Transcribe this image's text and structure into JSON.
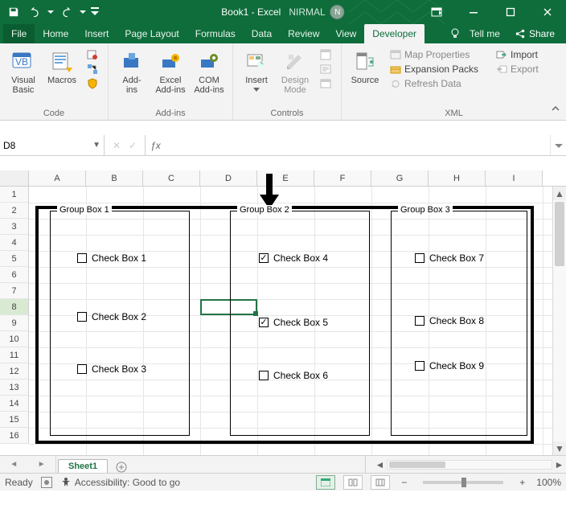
{
  "titlebar": {
    "app_title": "Book1  -  Excel",
    "username": "NIRMAL",
    "avatar_initial": "N"
  },
  "tabs": {
    "file": "File",
    "home": "Home",
    "insert": "Insert",
    "page_layout": "Page Layout",
    "formulas": "Formulas",
    "data": "Data",
    "review": "Review",
    "view": "View",
    "developer": "Developer",
    "tellme": "Tell me",
    "share": "Share"
  },
  "ribbon": {
    "code": {
      "label": "Code",
      "visual_basic": "Visual\nBasic",
      "macros": "Macros"
    },
    "addins": {
      "label": "Add-ins",
      "addins": "Add-\nins",
      "excel_addins": "Excel\nAdd-ins",
      "com_addins": "COM\nAdd-ins"
    },
    "controls": {
      "label": "Controls",
      "insert": "Insert",
      "design_mode": "Design\nMode"
    },
    "xml": {
      "label": "XML",
      "source": "Source",
      "map_properties": "Map Properties",
      "expansion_packs": "Expansion Packs",
      "refresh_data": "Refresh Data",
      "import": "Import",
      "export": "Export"
    }
  },
  "formula": {
    "namebox_value": "D8",
    "formula_value": ""
  },
  "grid": {
    "columns": [
      "A",
      "B",
      "C",
      "D",
      "E",
      "F",
      "G",
      "H",
      "I"
    ],
    "rows": [
      "1",
      "2",
      "3",
      "4",
      "5",
      "6",
      "7",
      "8",
      "9",
      "10",
      "11",
      "12",
      "13",
      "14",
      "15",
      "16"
    ],
    "selected_row": "8"
  },
  "shapes": {
    "groups": [
      {
        "label": "Group Box 1"
      },
      {
        "label": "Group Box 2"
      },
      {
        "label": "Group Box 3"
      }
    ],
    "checks": [
      {
        "label": "Check Box 1",
        "checked": false
      },
      {
        "label": "Check Box 2",
        "checked": false
      },
      {
        "label": "Check Box 3",
        "checked": false
      },
      {
        "label": "Check Box 4",
        "checked": true
      },
      {
        "label": "Check Box 5",
        "checked": true
      },
      {
        "label": "Check Box 6",
        "checked": false
      },
      {
        "label": "Check Box 7",
        "checked": false
      },
      {
        "label": "Check Box 8",
        "checked": false
      },
      {
        "label": "Check Box 9",
        "checked": false
      }
    ]
  },
  "sheet": {
    "tab1": "Sheet1"
  },
  "status": {
    "ready": "Ready",
    "accessibility": "Accessibility: Good to go",
    "zoom": "100%"
  }
}
